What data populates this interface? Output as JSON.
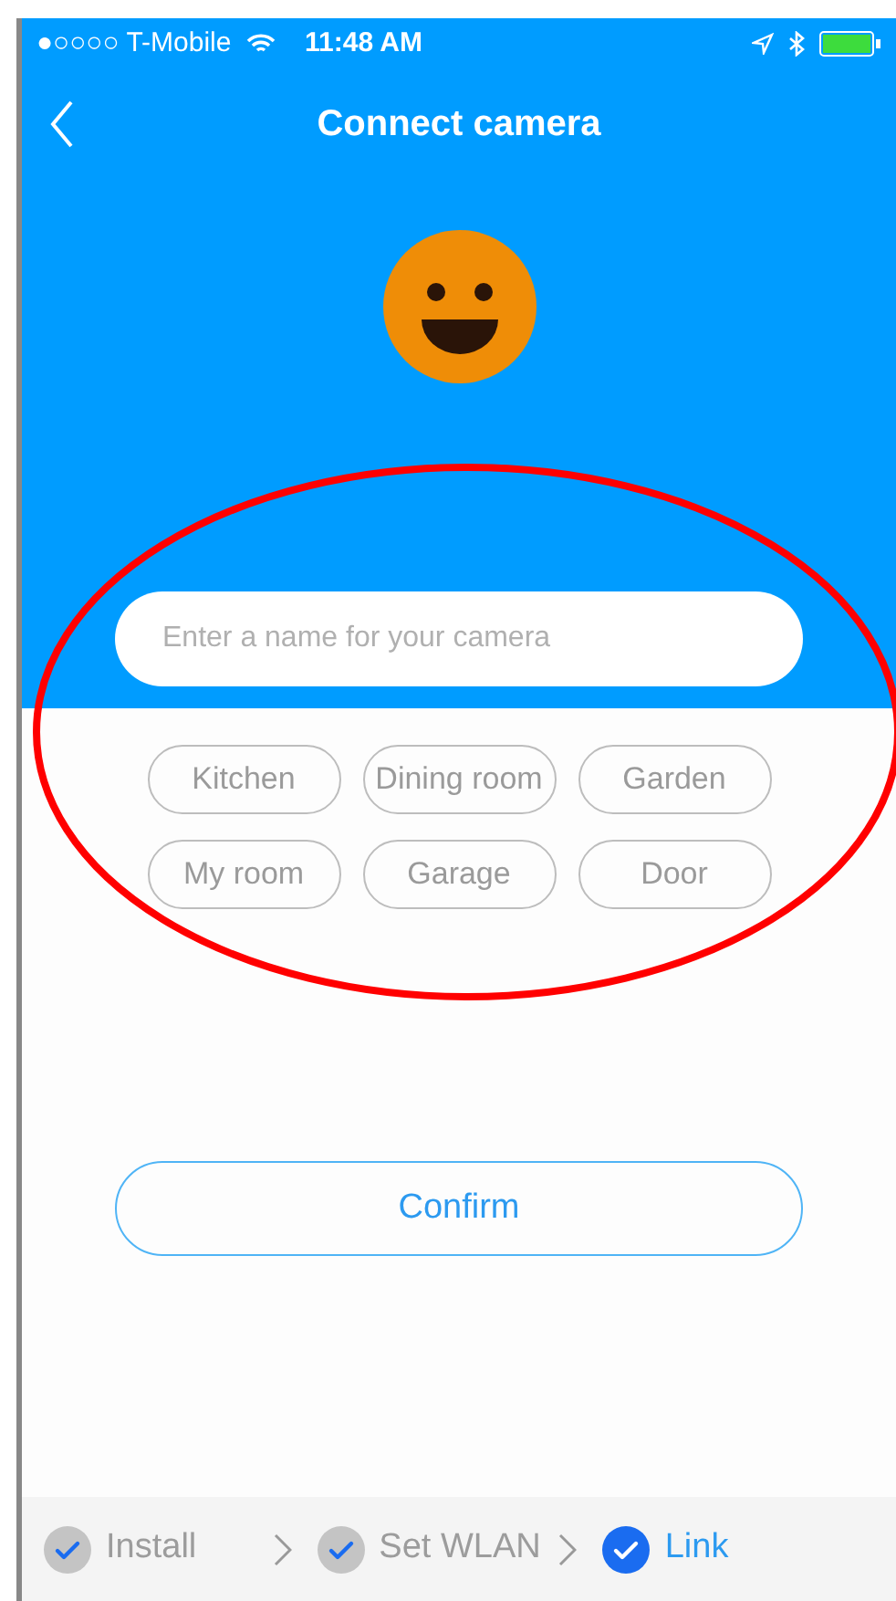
{
  "status_bar": {
    "carrier": "●○○○○ T-Mobile",
    "time": "11:48 AM"
  },
  "nav": {
    "title": "Connect camera"
  },
  "name_field": {
    "placeholder": "Enter a name for your camera"
  },
  "suggestions": [
    {
      "label": "Kitchen"
    },
    {
      "label": "Dining room"
    },
    {
      "label": "Garden"
    },
    {
      "label": "My room"
    },
    {
      "label": "Garage"
    },
    {
      "label": "Door"
    }
  ],
  "confirm_button": "Confirm",
  "steps": [
    {
      "label": "Install",
      "current": false
    },
    {
      "label": "Set WLAN",
      "current": false
    },
    {
      "label": "Link",
      "current": true
    }
  ]
}
